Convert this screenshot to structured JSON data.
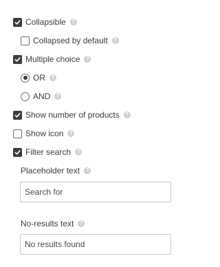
{
  "options": {
    "collapsible": {
      "label": "Collapsible",
      "checked": true
    },
    "collapsed_by_default": {
      "label": "Collapsed by default",
      "checked": false
    },
    "multiple_choice": {
      "label": "Multiple choice",
      "checked": true
    },
    "logic_or": {
      "label": "OR",
      "selected": true
    },
    "logic_and": {
      "label": "AND",
      "selected": false
    },
    "show_number_of_products": {
      "label": "Show number of products",
      "checked": true
    },
    "show_icon": {
      "label": "Show icon",
      "checked": false
    },
    "filter_search": {
      "label": "Filter search",
      "checked": true
    }
  },
  "fields": {
    "placeholder_text": {
      "label": "Placeholder text",
      "value": "Search for"
    },
    "no_results_text": {
      "label": "No-results text",
      "value": "No results found"
    }
  },
  "help_glyph": "?",
  "icons": {
    "help": "help-icon",
    "check": "checkmark-icon"
  },
  "colors": {
    "checkbox_checked": "#3d3d3d",
    "help_icon": "#cfcfcf",
    "text": "#3c3c3c",
    "input_border": "#c8c8c8"
  }
}
